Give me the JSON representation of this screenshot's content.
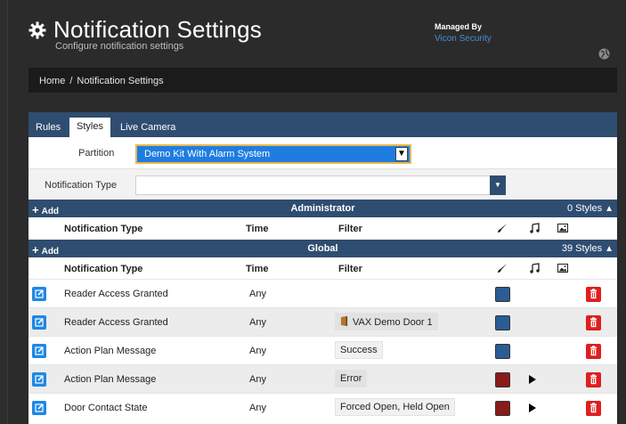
{
  "header": {
    "title": "Notification Settings",
    "subtitle": "Configure notification settings",
    "managed_by_label": "Managed By",
    "managed_by_value": "Vicon Security"
  },
  "breadcrumb": {
    "home": "Home",
    "separator": "/",
    "current": "Notification Settings"
  },
  "tabs": [
    {
      "label": "Rules",
      "active": false
    },
    {
      "label": "Styles",
      "active": true
    },
    {
      "label": "Live Camera",
      "active": false
    }
  ],
  "form": {
    "partition_label": "Partition",
    "partition_value": "Demo Kit With Alarm System",
    "type_label": "Notification Type",
    "type_value": ""
  },
  "sections": {
    "administrator": {
      "add_label": "Add",
      "name": "Administrator",
      "count": "0 Styles"
    },
    "global": {
      "add_label": "Add",
      "name": "Global",
      "count": "39 Styles"
    }
  },
  "columns": {
    "type": "Notification Type",
    "time": "Time",
    "filter": "Filter"
  },
  "colors": {
    "accent": "#2f4d70",
    "edit": "#1e88e5",
    "delete": "#e01e1e",
    "swatch_blue": "#2b5c94",
    "swatch_red": "#8a1b1b"
  },
  "rows": [
    {
      "type": "Reader Access Granted",
      "time": "Any",
      "filter": "",
      "filter_icon": false,
      "color": "#2b5c94",
      "sound": false
    },
    {
      "type": "Reader Access Granted",
      "time": "Any",
      "filter": "VAX Demo Door 1",
      "filter_icon": true,
      "color": "#2b5c94",
      "sound": false
    },
    {
      "type": "Action Plan Message",
      "time": "Any",
      "filter": "Success",
      "filter_icon": false,
      "color": "#2b5c94",
      "sound": false
    },
    {
      "type": "Action Plan Message",
      "time": "Any",
      "filter": "Error",
      "filter_icon": false,
      "color": "#8a1b1b",
      "sound": true
    },
    {
      "type": "Door Contact State",
      "time": "Any",
      "filter": "Forced Open, Held Open",
      "filter_icon": false,
      "color": "#8a1b1b",
      "sound": true
    }
  ]
}
